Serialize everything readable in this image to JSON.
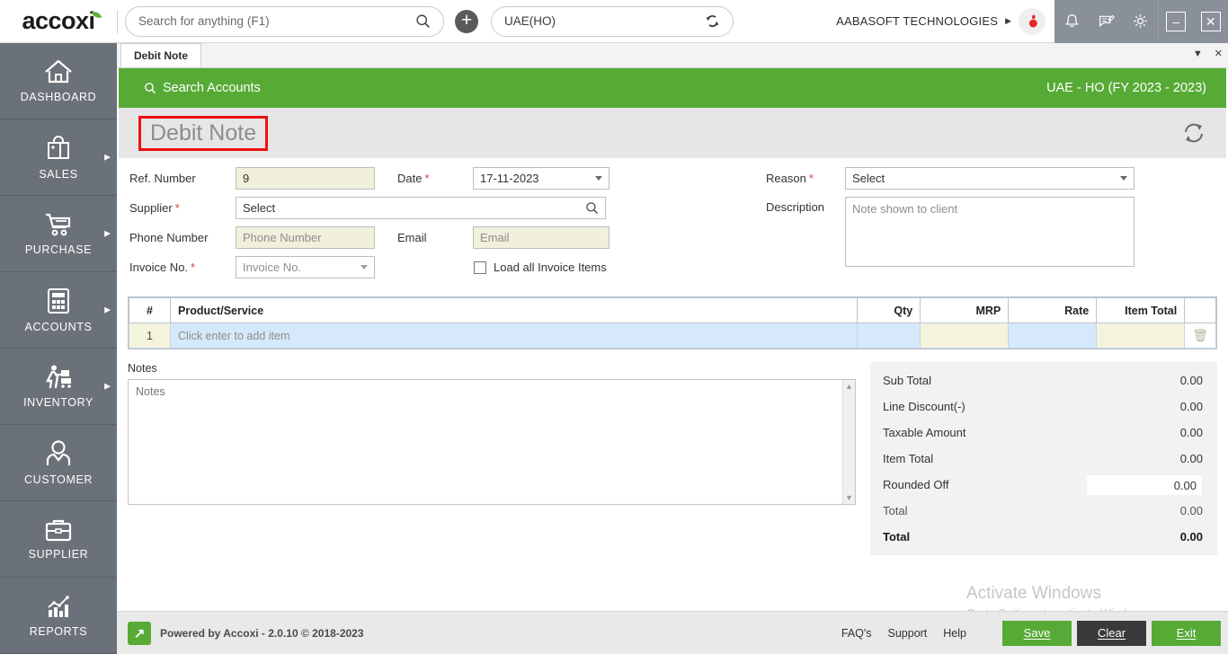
{
  "app": {
    "brand": "accoxi",
    "brand_accent": "#5cb335",
    "green": "#56aa35"
  },
  "topbar": {
    "search_placeholder": "Search for anything (F1)",
    "search_value": "",
    "add_label": "+",
    "branch_value": "UAE(HO)",
    "company_name": "AABASOFT TECHNOLOGIES",
    "company_caret": "▶",
    "icons": {
      "search": "search-icon",
      "sync": "sync-icon",
      "bell": "notification-bell-icon",
      "chat": "message-icon",
      "gear": "settings-gear-icon"
    },
    "window": {
      "minimize": "–",
      "close": "✕"
    }
  },
  "sidebar": {
    "items": [
      {
        "label": "DASHBOARD",
        "icon": "home-icon",
        "has_arrow": false
      },
      {
        "label": "SALES",
        "icon": "shopping-bag-icon",
        "has_arrow": true
      },
      {
        "label": "PURCHASE",
        "icon": "shopping-cart-icon",
        "has_arrow": true
      },
      {
        "label": "ACCOUNTS",
        "icon": "calculator-icon",
        "has_arrow": true
      },
      {
        "label": "INVENTORY",
        "icon": "warehouse-worker-icon",
        "has_arrow": true
      },
      {
        "label": "CUSTOMER",
        "icon": "person-icon",
        "has_arrow": false
      },
      {
        "label": "SUPPLIER",
        "icon": "briefcase-icon",
        "has_arrow": false
      },
      {
        "label": "REPORTS",
        "icon": "bar-chart-icon",
        "has_arrow": false
      }
    ]
  },
  "tabs": {
    "active": "Debit Note",
    "dropdown_glyph": "▼",
    "close_glyph": "✕"
  },
  "greenbar": {
    "search_accounts": "Search Accounts",
    "fiscal": "UAE - HO (FY 2023 - 2023)"
  },
  "titlebar": {
    "doc_title": "Debit Note",
    "refresh_icon": "refresh-icon"
  },
  "form": {
    "ref_number": {
      "label": "Ref. Number",
      "value": "9",
      "required": false
    },
    "date": {
      "label": "Date",
      "value": "17-11-2023",
      "required": true
    },
    "supplier": {
      "label": "Supplier",
      "value": "Select",
      "required": true
    },
    "phone": {
      "label": "Phone Number",
      "placeholder": "Phone Number",
      "value": "",
      "required": false
    },
    "email": {
      "label": "Email",
      "placeholder": "Email",
      "value": "",
      "required": false
    },
    "invoice_no": {
      "label": "Invoice No.",
      "placeholder": "Invoice No.",
      "value": "",
      "required": true
    },
    "load_all": {
      "label": "Load all Invoice Items",
      "checked": false
    },
    "reason": {
      "label": "Reason",
      "value": "Select",
      "required": true
    },
    "description": {
      "label": "Description",
      "placeholder": "Note shown to client",
      "value": ""
    }
  },
  "items_table": {
    "columns": [
      "#",
      "Product/Service",
      "Qty",
      "MRP",
      "Rate",
      "Item Total",
      ""
    ],
    "rows": [
      {
        "index": "1",
        "product": "Click enter to add item",
        "qty": "",
        "mrp": "",
        "rate": "",
        "item_total": "",
        "delete_icon": "trash-icon"
      }
    ]
  },
  "notes": {
    "label": "Notes",
    "placeholder": "Notes",
    "value": ""
  },
  "totals": {
    "rows": [
      {
        "label": "Sub Total",
        "value": "0.00",
        "editable": false,
        "bold": false
      },
      {
        "label": "Line Discount(-)",
        "value": "0.00",
        "editable": false,
        "bold": false
      },
      {
        "label": "Taxable Amount",
        "value": "0.00",
        "editable": false,
        "bold": false
      },
      {
        "label": "Item Total",
        "value": "0.00",
        "editable": false,
        "bold": false
      },
      {
        "label": "Rounded Off",
        "value": "0.00",
        "editable": true,
        "bold": false
      },
      {
        "label": "Total",
        "value": "0.00",
        "editable": false,
        "bold": false
      },
      {
        "label": "Total",
        "value": "0.00",
        "editable": false,
        "bold": true
      }
    ]
  },
  "watermark": {
    "line1": "Activate Windows",
    "line2": "Go to Settings to activate Windows."
  },
  "footer": {
    "powered": "Powered by Accoxi - 2.0.10 © 2018-2023",
    "links": [
      "FAQ's",
      "Support",
      "Help"
    ],
    "buttons": [
      {
        "label": "Save",
        "accel": "S",
        "style": "green"
      },
      {
        "label": "Clear",
        "accel": "C",
        "style": "dark"
      },
      {
        "label": "Exit",
        "accel": "E",
        "style": "green"
      }
    ]
  }
}
